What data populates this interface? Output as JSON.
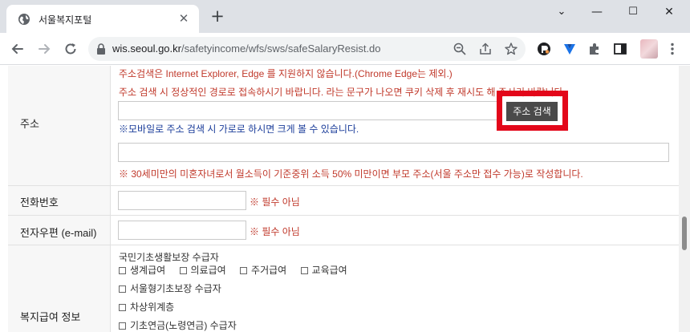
{
  "browser": {
    "tab_title": "서울복지포털",
    "tab_close": "✕",
    "new_tab": "+",
    "url_host": "wis.seoul.go.kr",
    "url_path": "/safetyincome/wfs/sws/safeSalaryResist.do",
    "window_controls": [
      "⌄",
      "—",
      "☐",
      "✕"
    ]
  },
  "form": {
    "address": {
      "label": "주소",
      "notice_line1": "주소검색은 Internet Explorer, Edge 를 지원하지 않습니다.(Chrome Edge는 제외.)",
      "notice_line2": "주소 검색 시 정상적인 경로로 접속하시기 바랍니다. 라는 문구가 나오면 쿠키 삭제 후 재시도 해 주시기 바랍니다.",
      "search_button": "주소 검색",
      "mobile_note": "※모바일로 주소 검색 시 가로로 하시면 크게 볼 수 있습니다.",
      "under30_note": "※ 30세미만의 미혼자녀로서 월소득이 기준중위 소득 50% 미만이면 부모 주소(서울 주소만 접수 가능)로 작성합니다."
    },
    "phone": {
      "label": "전화번호",
      "note": "※ 필수 아님"
    },
    "email": {
      "label": "전자우편 (e-mail)",
      "note": "※ 필수 아님"
    },
    "welfare": {
      "label": "복지급여 정보",
      "basic_title": "국민기초생활보장 수급자",
      "basic_items": [
        "생계급여",
        "의료급여",
        "주거급여",
        "교육급여"
      ],
      "seoul_basic": "서울형기초보장 수급자",
      "near_poor": "차상위계층",
      "pension": "기초연금(노령연금) 수급자"
    }
  }
}
